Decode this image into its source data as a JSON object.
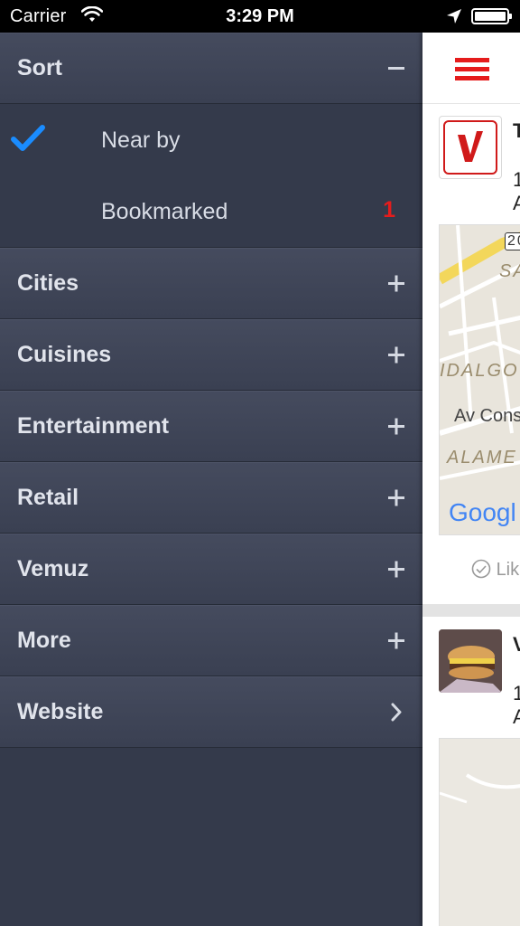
{
  "status_bar": {
    "carrier": "Carrier",
    "time": "3:29 PM"
  },
  "drawer": {
    "sort": {
      "label": "Sort",
      "toggle": "−",
      "options": [
        {
          "label": "Near by",
          "checked": true
        },
        {
          "label": "Bookmarked",
          "count": "1"
        }
      ]
    },
    "sections": [
      {
        "label": "Cities",
        "toggle": "+"
      },
      {
        "label": "Cuisines",
        "toggle": "+"
      },
      {
        "label": "Entertainment",
        "toggle": "+"
      },
      {
        "label": "Retail",
        "toggle": "+"
      },
      {
        "label": "Vemuz",
        "toggle": "+"
      },
      {
        "label": "More",
        "toggle": "+"
      },
      {
        "label": "Website",
        "toggle": "›"
      }
    ]
  },
  "content": {
    "card1": {
      "title_partial": "T",
      "line1_partial": "1",
      "line2_partial": "A",
      "map_labels": [
        "20",
        "SA",
        "IDALGO",
        "Av Cons",
        "ALAME"
      ],
      "map_brand": "Googl",
      "like_label": "Lik"
    },
    "card2": {
      "title_partial": "V",
      "line1_partial": "1",
      "line2_partial": "A"
    }
  },
  "colors": {
    "accent_red": "#e51c1c",
    "check_blue": "#1a8cff",
    "drawer_bg": "#343a4b"
  },
  "icons": [
    "wifi-icon",
    "location-arrow-icon",
    "battery-icon",
    "checkmark-icon",
    "minus-icon",
    "plus-icon",
    "chevron-right-icon",
    "hamburger-menu-icon"
  ]
}
